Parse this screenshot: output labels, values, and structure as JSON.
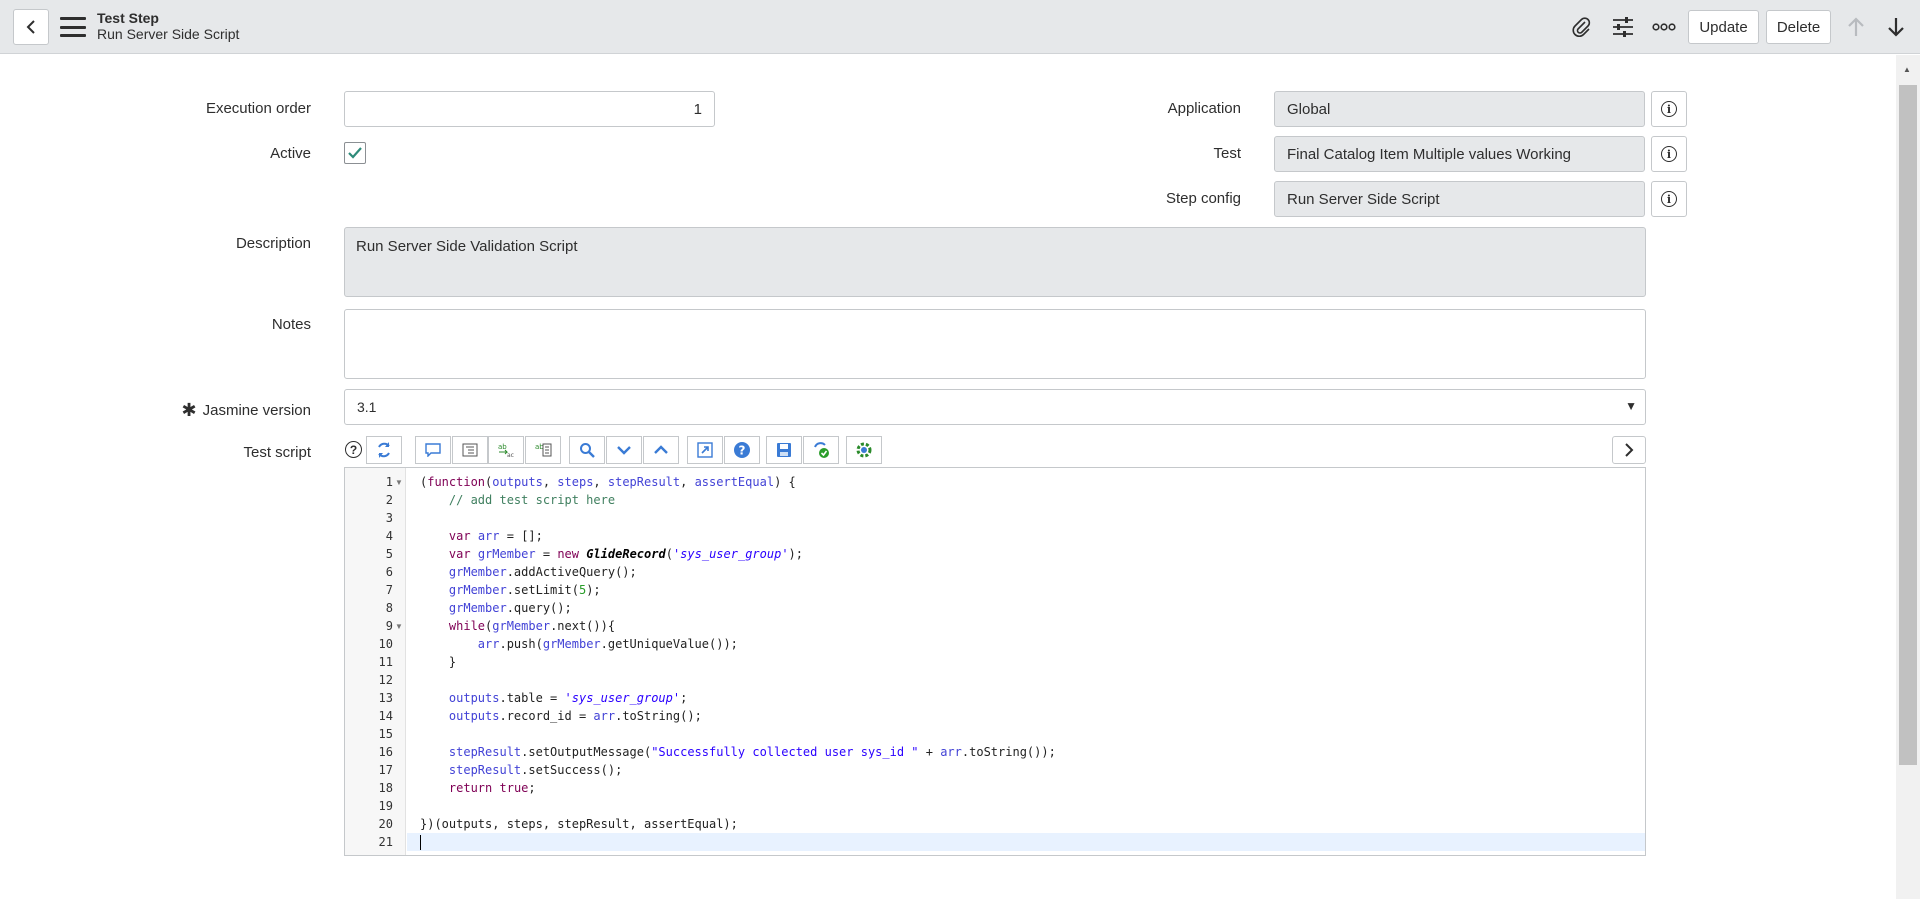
{
  "header": {
    "title": "Test Step",
    "subtitle": "Run Server Side Script",
    "update_label": "Update",
    "delete_label": "Delete"
  },
  "form": {
    "execution_order": {
      "label": "Execution order",
      "value": "1"
    },
    "active": {
      "label": "Active",
      "checked": true
    },
    "application": {
      "label": "Application",
      "value": "Global"
    },
    "test": {
      "label": "Test",
      "value": "Final Catalog Item Multiple values Working"
    },
    "step_config": {
      "label": "Step config",
      "value": "Run Server Side Script"
    },
    "description": {
      "label": "Description",
      "value": "Run Server Side Validation Script"
    },
    "notes": {
      "label": "Notes",
      "value": ""
    },
    "jasmine_version": {
      "label": "Jasmine version",
      "value": "3.1",
      "required_mark": "✱"
    },
    "test_script": {
      "label": "Test script",
      "help": "?"
    }
  },
  "editor": {
    "line_numbers": [
      "1",
      "2",
      "3",
      "4",
      "5",
      "6",
      "7",
      "8",
      "9",
      "10",
      "11",
      "12",
      "13",
      "14",
      "15",
      "16",
      "17",
      "18",
      "19",
      "20",
      "21"
    ]
  },
  "colors": {
    "header_bg": "#e6e8ea",
    "readonly_bg": "#e6e8ea",
    "check_color": "#2e8b7a",
    "toolbar_icon": "#3a7bd5"
  }
}
